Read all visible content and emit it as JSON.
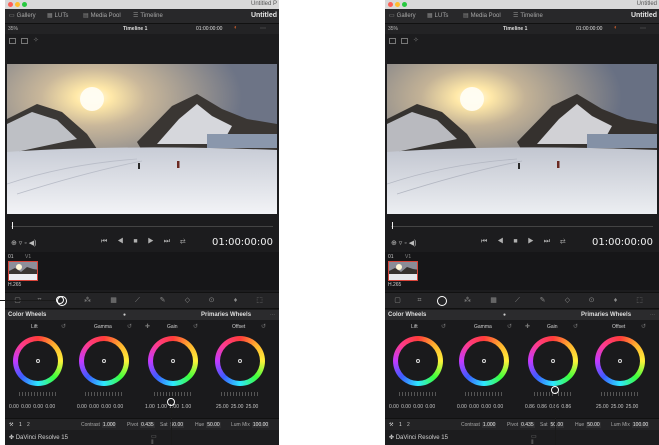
{
  "window": {
    "title": "Untitled P",
    "title_right": "Untitled"
  },
  "toolbar": {
    "gallery_label": "Gallery",
    "luts_label": "LUTs",
    "media_pool_label": "Media Pool",
    "timeline_label": "Timeline",
    "project_left": "Untitled",
    "project_right": "Untitled"
  },
  "viewer": {
    "zoom": "35%",
    "timeline_name": "Timeline 1",
    "timecode": "01:00:00:00"
  },
  "transport": {
    "timecode": "01:00:00:00"
  },
  "clip": {
    "number": "01",
    "track": "V1",
    "codec": "H.265"
  },
  "color_panel": {
    "title": "Color Wheels",
    "mode": "Primaries Wheels"
  },
  "left": {
    "wheels": [
      {
        "label": "Lift",
        "values": "0.00 0.00 0.00 0.00"
      },
      {
        "label": "Gamma",
        "values": "0.00 0.00 0.00 0.00"
      },
      {
        "label": "Gain",
        "values": "1.00 1.00 1.00 1.00"
      },
      {
        "label": "Offset",
        "values": "25.00 25.00 25.00"
      }
    ]
  },
  "right": {
    "wheels": [
      {
        "label": "Lift",
        "values": "0.00 0.00 0.00 0.00"
      },
      {
        "label": "Gamma",
        "values": "0.00 0.00 0.00 0.00"
      },
      {
        "label": "Gain",
        "values": "0.86 0.86 0.86 0.86"
      },
      {
        "label": "Offset",
        "values": "25.00 25.00 25.00"
      }
    ]
  },
  "adjust": {
    "page_a": "1",
    "page_b": "2",
    "contrast_label": "Contrast",
    "contrast_value": "1.000",
    "pivot_label": "Pivot",
    "pivot_value": "0.435",
    "sat_label": "Sat",
    "sat_value": "50.00",
    "hue_label": "Hue",
    "hue_value": "50.00",
    "lum_mix_label": "Lum Mix",
    "lum_mix_value": "100.00"
  },
  "app": {
    "name": "DaVinci Resolve 15"
  },
  "colors": {
    "accent_red": "#d9463b",
    "panel_bg": "#1c1c1e"
  }
}
